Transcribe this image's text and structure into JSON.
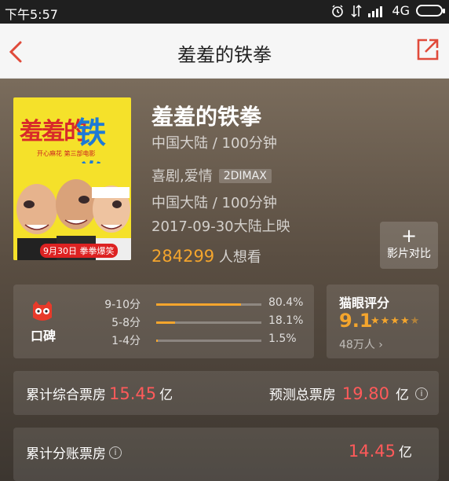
{
  "status_bar": {
    "time": "下午5:57",
    "network": "4G"
  },
  "nav": {
    "title": "羞羞的铁拳"
  },
  "poster": {
    "title_part1": "羞羞的",
    "title_part2": "铁拳",
    "tagline": "开心麻花 第三部电影",
    "date_badge": "9月30日 拳拳爆笑"
  },
  "movie": {
    "title": "羞羞的铁拳",
    "line1": "中国大陆 / 100分钟",
    "genres": "喜剧,爱情",
    "format_tag": "2DIMAX",
    "line3": "中国大陆 / 100分钟",
    "release": "2017-09-30大陆上映",
    "want_count": "284299",
    "want_label": "人想看"
  },
  "compare_button": {
    "plus": "+",
    "label": "影片对比"
  },
  "koubei": {
    "label": "口碑",
    "rows": [
      {
        "range": "9-10分",
        "percent_text": "80.4%",
        "percent": 80.4
      },
      {
        "range": "5-8分",
        "percent_text": "18.1%",
        "percent": 18.1
      },
      {
        "range": "1-4分",
        "percent_text": "1.5%",
        "percent": 1.5
      }
    ]
  },
  "maoyan": {
    "title": "猫眼评分",
    "score": "9.1",
    "stars": 4.5,
    "count": "48万人"
  },
  "box_office": {
    "total_label": "累计综合票房",
    "total_value": "15.45",
    "total_unit": "亿",
    "predict_label": "预测总票房",
    "predict_value": "19.80",
    "predict_unit": "亿",
    "split_label": "累计分账票房",
    "split_value": "14.45",
    "split_unit": "亿"
  },
  "colors": {
    "accent": "#f4a52d",
    "brand_red": "#e04a3a",
    "value_red": "#ff5a5a"
  }
}
